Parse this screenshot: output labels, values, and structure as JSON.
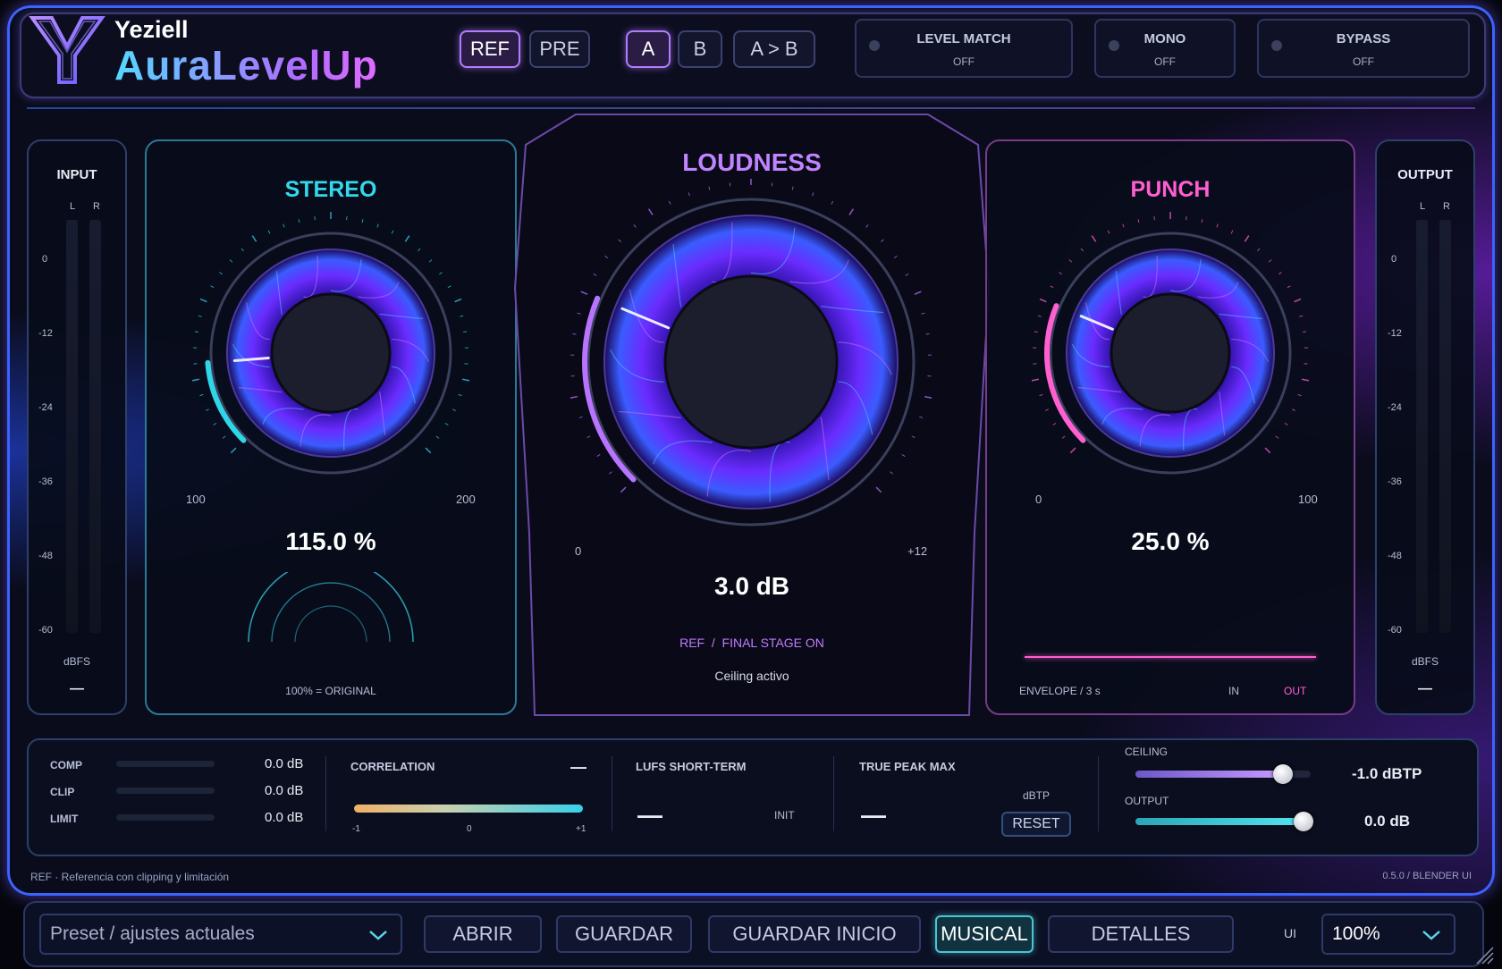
{
  "header": {
    "brand": "Yeziell",
    "product": "AuraLevelUp",
    "buttons": {
      "ref": "REF",
      "pre": "PRE",
      "a": "A",
      "b": "B",
      "a_to_b": "A > B"
    },
    "toggles": [
      {
        "label": "LEVEL MATCH",
        "value": "OFF"
      },
      {
        "label": "MONO",
        "value": "OFF"
      },
      {
        "label": "BYPASS",
        "value": "OFF"
      }
    ]
  },
  "input_meter": {
    "title": "INPUT",
    "l": "L",
    "r": "R",
    "ticks": [
      "0",
      "-12",
      "-24",
      "-36",
      "-48",
      "-60"
    ],
    "unit": "dBFS",
    "readout": "—"
  },
  "output_meter": {
    "title": "OUTPUT",
    "l": "L",
    "r": "R",
    "ticks": [
      "0",
      "-12",
      "-24",
      "-36",
      "-48",
      "-60"
    ],
    "unit": "dBFS",
    "readout": "—"
  },
  "stereo": {
    "title": "STEREO",
    "min": "100",
    "max": "200",
    "value": "115.0 %",
    "level": 0.15,
    "note": "100% = ORIGINAL",
    "accent": "#2fd6e8"
  },
  "loudness": {
    "title": "LOUDNESS",
    "min": "0",
    "max": "+12",
    "value": "3.0 dB",
    "level": 0.25,
    "status_ref": "REF",
    "status_sep": "/",
    "status_final": "FINAL STAGE ON",
    "ceiling": "Ceiling activo",
    "accent": "#b873ff"
  },
  "punch": {
    "title": "PUNCH",
    "min": "0",
    "max": "100",
    "value": "25.0 %",
    "level": 0.25,
    "envelope": "ENVELOPE / 3 s",
    "in": "IN",
    "out": "OUT",
    "accent": "#ff5fd0"
  },
  "dynamics": [
    {
      "label": "COMP",
      "value": "0.0 dB"
    },
    {
      "label": "CLIP",
      "value": "0.0 dB"
    },
    {
      "label": "LIMIT",
      "value": "0.0 dB"
    }
  ],
  "correlation": {
    "label": "CORRELATION",
    "value": "—",
    "ticks": [
      "-1",
      "0",
      "+1"
    ]
  },
  "lufs": {
    "label": "LUFS SHORT-TERM",
    "value": "—",
    "init": "INIT"
  },
  "truepeak": {
    "label": "TRUE PEAK MAX",
    "value": "—",
    "unit": "dBTP",
    "reset": "RESET"
  },
  "ceiling": {
    "label": "CEILING",
    "value": "-1.0 dBTP",
    "level": 0.84
  },
  "output_gain": {
    "label": "OUTPUT",
    "value": "0.0 dB",
    "level": 0.96
  },
  "statusbar": {
    "left": "REF · Referencia con clipping y limitación",
    "right": "0.5.0 / BLENDER UI"
  },
  "footer": {
    "preset_placeholder": "Preset / ajustes actuales",
    "abrir": "ABRIR",
    "guardar": "GUARDAR",
    "guardar_inicio": "GUARDAR INICIO",
    "musical": "MUSICAL",
    "detalles": "DETALLES",
    "ui_label": "UI",
    "zoom": "100%"
  }
}
